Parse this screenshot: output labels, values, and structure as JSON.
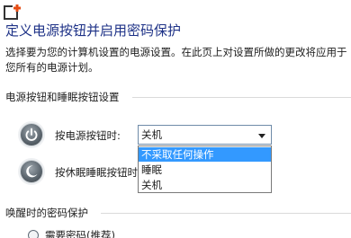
{
  "page": {
    "title": "定义电源按钮并启用密码保护",
    "description": "选择要为您的计算机设置的电源设置。在此页上对设置所做的更改将应用于您所有的电源计划。"
  },
  "sections": {
    "buttons_title": "电源按钮和睡眠按钮设置",
    "password_title": "唤醒时的密码保护"
  },
  "power_button": {
    "label": "按电源按钮时:",
    "selected": "关机",
    "options": [
      "不采取任何操作",
      "睡眠",
      "关机"
    ],
    "highlighted_option": "不采取任何操作"
  },
  "sleep_button": {
    "label": "按休眠睡眠按钮时:"
  },
  "password": {
    "partial_option_label": "需要密码(推荐)"
  },
  "icons": {
    "app_logo": "app-logo-icon",
    "power": "power-button-icon",
    "sleep": "sleep-button-icon",
    "dropdown_arrow": "chevron-down-icon"
  },
  "colors": {
    "title": "#1e3287",
    "highlight": "#3399ff",
    "logo_accent": "#e64c14"
  }
}
